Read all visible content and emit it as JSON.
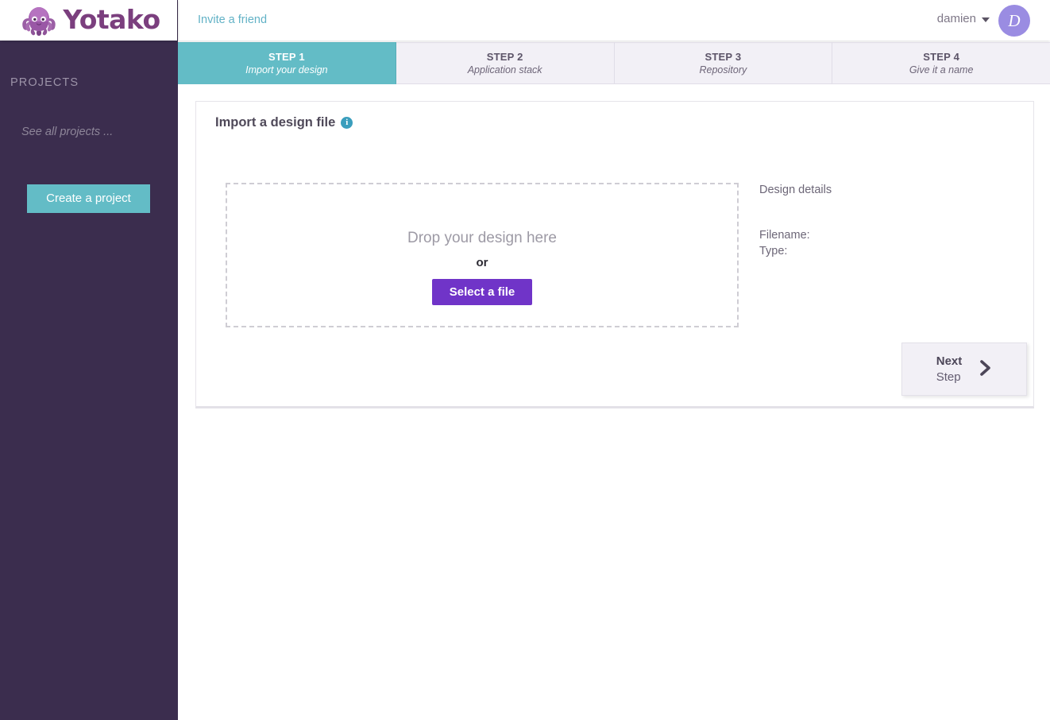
{
  "brand": {
    "name": "Yotako",
    "logo_icon": "octopus-icon",
    "logo_color": "#7b3f7e"
  },
  "colors": {
    "sidebar_bg": "#3b2d4e",
    "accent_teal": "#63bcc6",
    "accent_purple": "#7034c8",
    "avatar_purple": "#9a8ce2",
    "info_icon": "#3a9ebd"
  },
  "topbar": {
    "invite_label": "Invite a friend",
    "user_name": "damien",
    "avatar_initial": "D",
    "caret_icon": "chevron-down-icon"
  },
  "sidebar": {
    "section_label": "PROJECTS",
    "see_all_label": "See all projects ...",
    "create_button_label": "Create a project"
  },
  "steps": [
    {
      "title": "STEP 1",
      "subtitle": "Import your design",
      "active": true
    },
    {
      "title": "STEP 2",
      "subtitle": "Application stack",
      "active": false
    },
    {
      "title": "STEP 3",
      "subtitle": "Repository",
      "active": false
    },
    {
      "title": "STEP 4",
      "subtitle": "Give it a name",
      "active": false
    }
  ],
  "card": {
    "title": "Import a design file",
    "info_icon": "info-icon",
    "info_glyph": "i",
    "dropzone": {
      "drop_text": "Drop your design here",
      "or_text": "or",
      "select_button_label": "Select a file"
    },
    "design_details": {
      "title": "Design details",
      "filename_label": "Filename:",
      "filename_value": "",
      "type_label": "Type:",
      "type_value": ""
    }
  },
  "next_step_button": {
    "line1": "Next",
    "line2": "Step",
    "icon": "chevron-right-icon",
    "glyph": "›"
  }
}
